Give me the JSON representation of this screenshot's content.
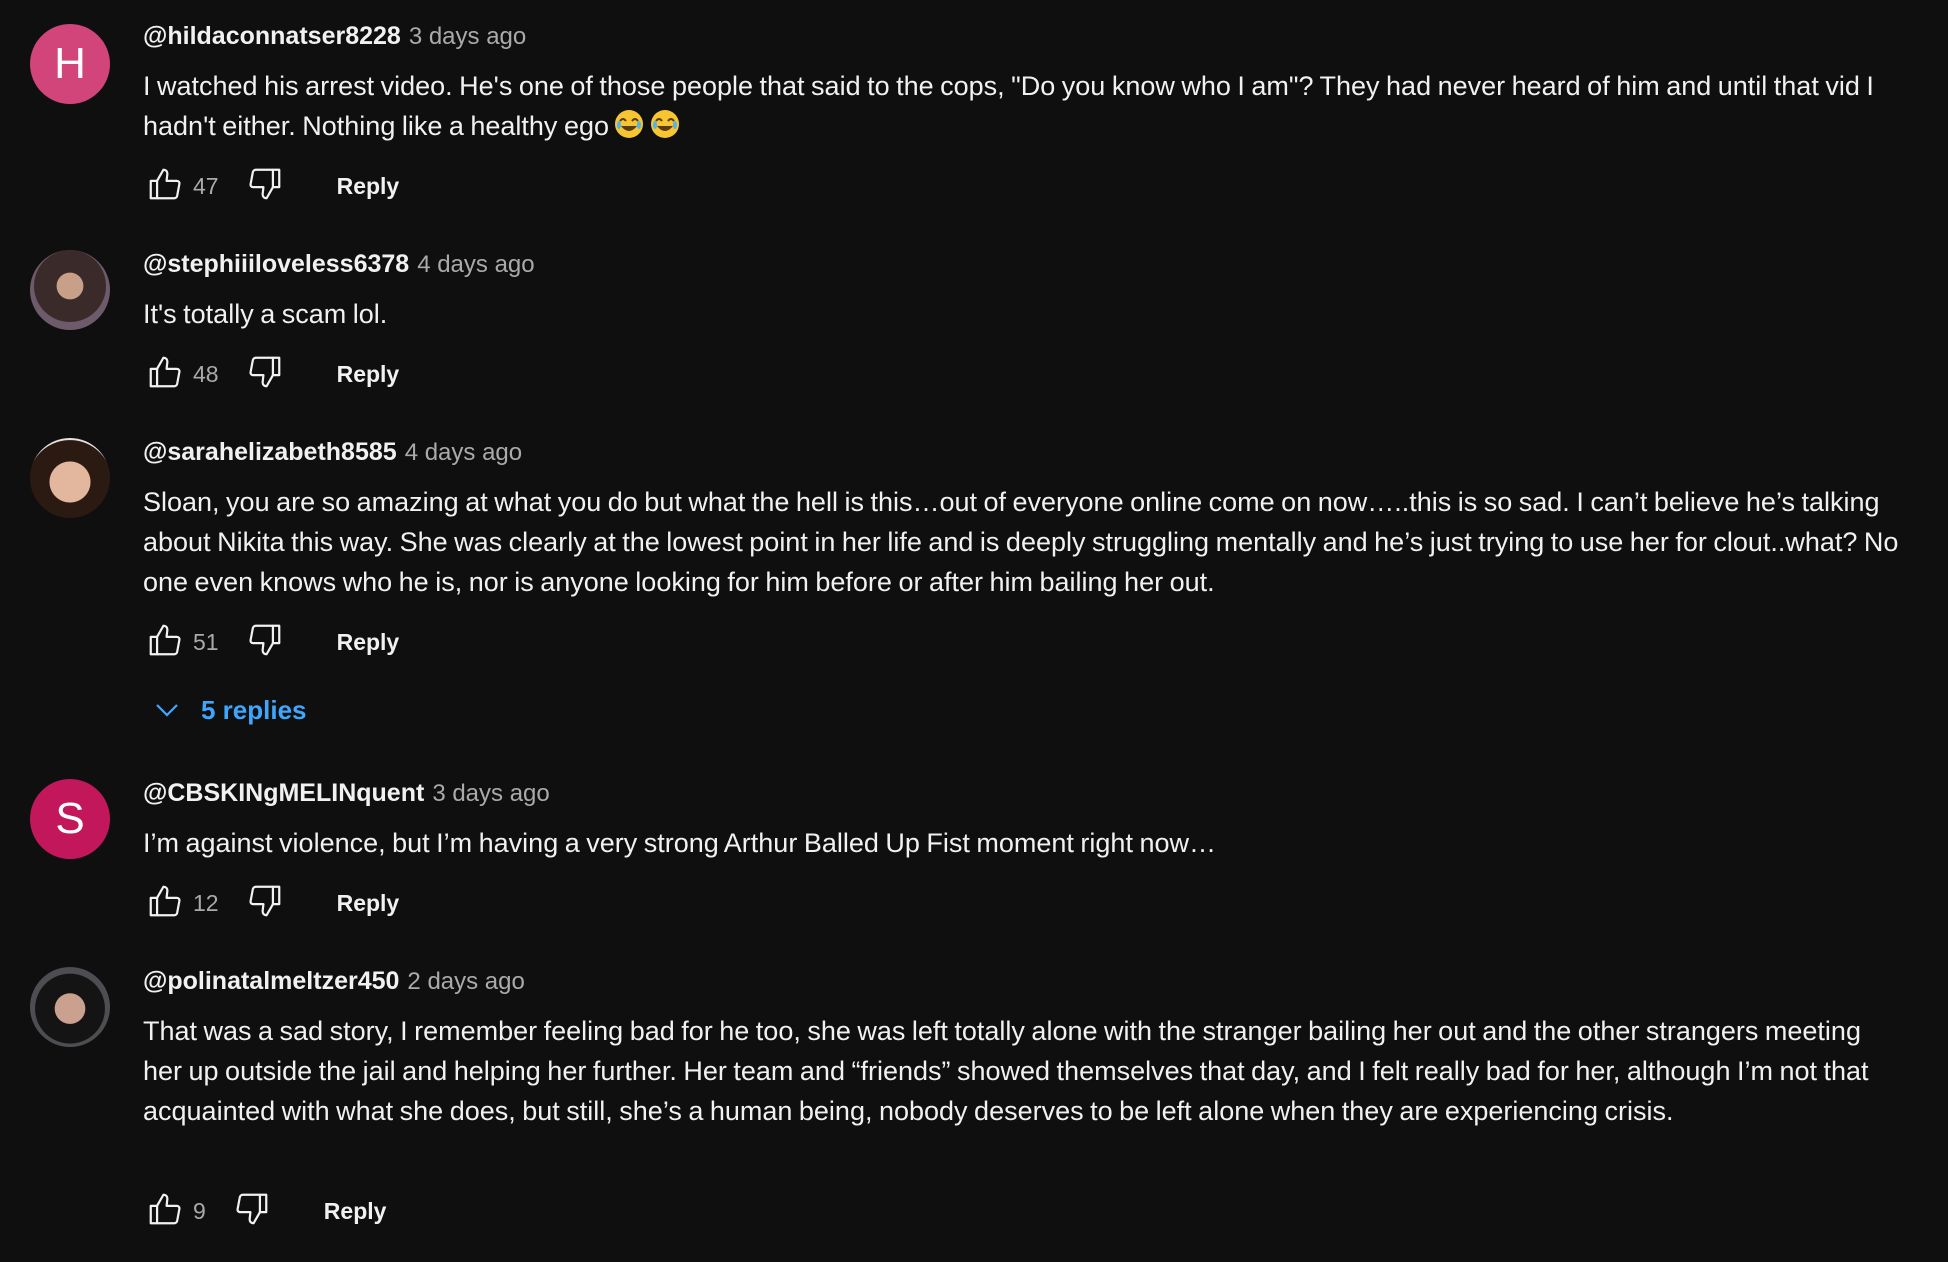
{
  "comments": [
    {
      "avatar_letter": "H",
      "avatar_color": "#d2457a",
      "handle": "@hildaconnatser8228",
      "time": "3 days ago",
      "text": "I watched his arrest video. He's one of those people that said to the cops, \"Do you know who I am\"? They had never heard of him and until that vid I hadn't either. Nothing like a healthy ego",
      "emojis": [
        "😂",
        "😂"
      ],
      "likes": "47",
      "reply_label": "Reply"
    },
    {
      "avatar_icon": "profile-photo",
      "handle": "@stephiiiloveless6378",
      "time": "4 days ago",
      "text": "It's totally a scam lol.",
      "likes": "48",
      "reply_label": "Reply"
    },
    {
      "avatar_icon": "profile-photo",
      "handle": "@sarahelizabeth8585",
      "time": "4 days ago",
      "text": "Sloan, you are so amazing at what you do but what the hell is this…out of everyone online come on now…..this is so sad. I can’t believe he’s talking about Nikita this way. She was clearly at the lowest point in her life and is deeply struggling mentally and he’s just trying to use her for clout..what? No one even knows who he is, nor is anyone looking for him before or after him bailing her out.",
      "likes": "51",
      "reply_label": "Reply",
      "replies_label": "5 replies"
    },
    {
      "avatar_letter": "S",
      "avatar_color": "#c2185b",
      "handle": "@CBSKINgMELINquent",
      "time": "3 days ago",
      "text": "I’m against violence, but I’m having a very strong Arthur Balled Up Fist moment right now…",
      "likes": "12",
      "reply_label": "Reply"
    },
    {
      "avatar_icon": "profile-photo",
      "handle": "@polinatalmeltzer450",
      "time": "2 days ago",
      "text": "That was a sad story, I remember feeling bad for he too, she was left totally alone with the stranger bailing her out and the other strangers meeting her up outside the jail and helping her further. Her team and “friends” showed themselves that day, and I felt really bad for her, although I’m not that acquainted with what she does, but still, she’s a human being, nobody deserves to be left alone when they are experiencing crisis.",
      "likes": "9",
      "reply_label": "Reply"
    }
  ],
  "icons": {
    "like": "thumbs-up-icon",
    "dislike": "thumbs-down-icon",
    "expand": "chevron-down-icon"
  },
  "colors": {
    "background": "#0f0f0f",
    "primary_text": "#f1f1f1",
    "secondary_text": "#aaaaaa",
    "link_blue": "#3ea6ff"
  }
}
